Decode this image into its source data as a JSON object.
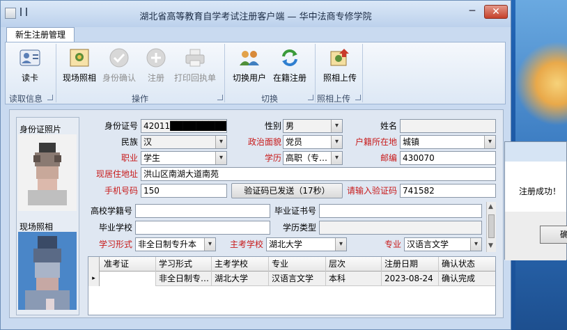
{
  "window": {
    "title": "湖北省高等教育自学考试注册客户端 — 华中法商专修学院",
    "min_glyph": "─",
    "max_glyph": "",
    "close_glyph": "✕"
  },
  "tabs": [
    {
      "label": "新生注册管理"
    }
  ],
  "ribbon": {
    "buttons": [
      {
        "label": "读卡",
        "icon": "id-card-icon",
        "enabled": true
      },
      {
        "label": "现场照相",
        "icon": "photo-icon",
        "enabled": true
      },
      {
        "label": "身份确认",
        "icon": "check-icon",
        "enabled": false
      },
      {
        "label": "注册",
        "icon": "plus-icon",
        "enabled": false
      },
      {
        "label": "打印回执单",
        "icon": "printer-icon",
        "enabled": false
      },
      {
        "label": "切换用户",
        "icon": "users-icon",
        "enabled": true
      },
      {
        "label": "在籍注册",
        "icon": "refresh-icon",
        "enabled": true
      },
      {
        "label": "照相上传",
        "icon": "upload-photo-icon",
        "enabled": true
      }
    ],
    "groups": [
      "读取信息",
      "操作",
      "切换",
      "照相上传"
    ]
  },
  "photos": {
    "id_photo_label": "身份证照片",
    "live_photo_label": "现场照相"
  },
  "form": {
    "id_number": {
      "label": "身份证号",
      "value": "42011█████████1625"
    },
    "gender": {
      "label": "性别",
      "value": "男"
    },
    "name": {
      "label": "姓名",
      "value": ""
    },
    "ethnicity": {
      "label": "民族",
      "value": "汉"
    },
    "political": {
      "label": "政治面貌",
      "value": "党员"
    },
    "household": {
      "label": "户籍所在地",
      "value": "城镇"
    },
    "occupation": {
      "label": "职业",
      "value": "学生"
    },
    "education": {
      "label": "学历",
      "value": "高职（专…"
    },
    "postcode": {
      "label": "邮编",
      "value": "430070"
    },
    "address": {
      "label": "现居住地址",
      "value": "洪山区南湖大道南苑"
    },
    "phone": {
      "label": "手机号码",
      "value": "150"
    },
    "verify_button": "验证码已发送（17秒）",
    "verify_code": {
      "label": "请输入验证码",
      "value": "741582"
    },
    "college_id": {
      "label": "高校学籍号",
      "value": ""
    },
    "grad_cert": {
      "label": "毕业证书号",
      "value": ""
    },
    "grad_school": {
      "label": "毕业学校",
      "value": ""
    },
    "edu_type": {
      "label": "学历类型",
      "value": ""
    },
    "study_form": {
      "label": "学习形式",
      "value": "非全日制专升本"
    },
    "main_school": {
      "label": "主考学校",
      "value": "湖北大学"
    },
    "major": {
      "label": "专业",
      "value": "汉语言文学"
    }
  },
  "grid": {
    "columns": [
      "准考证",
      "学习形式",
      "主考学校",
      "专业",
      "层次",
      "注册日期",
      "确认状态"
    ],
    "rows": [
      [
        "",
        "非全日制专…",
        "湖北大学",
        "汉语言文学",
        "本科",
        "2023-08-24",
        "确认完成"
      ]
    ],
    "row_marker": "▸"
  },
  "dialog": {
    "message": "注册成功！",
    "ok_label": "确"
  }
}
